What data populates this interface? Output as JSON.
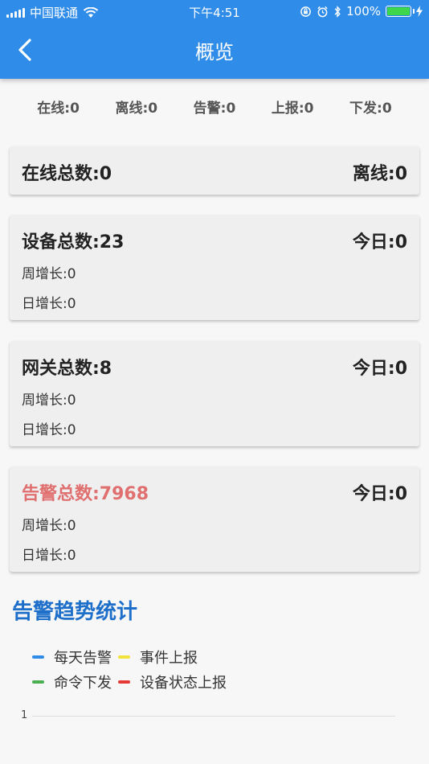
{
  "status_bar": {
    "carrier": "中国联通",
    "time": "下午4:51",
    "battery": "100%",
    "battery_level": 1.0
  },
  "header": {
    "title": "概览",
    "back_icon": "chevron-left-icon"
  },
  "summary": [
    {
      "label": "在线:0"
    },
    {
      "label": "离线:0"
    },
    {
      "label": "告警:0"
    },
    {
      "label": "上报:0"
    },
    {
      "label": "下发:0"
    }
  ],
  "online_card": {
    "total": "在线总数:0",
    "offline": "离线:0"
  },
  "device_card": {
    "total": "设备总数:23",
    "today": "今日:0",
    "weekly": "周增长:0",
    "daily": "日增长:0"
  },
  "gateway_card": {
    "total": "网关总数:8",
    "today": "今日:0",
    "weekly": "周增长:0",
    "daily": "日增长:0"
  },
  "alarm_card": {
    "total": "告警总数:7968",
    "today": "今日:0",
    "weekly": "周增长:0",
    "daily": "日增长:0",
    "accent": "#e07070"
  },
  "trend": {
    "title": "告警趋势统计",
    "legend": [
      {
        "label": "每天告警",
        "color": "#2f8ce8"
      },
      {
        "label": "事件上报",
        "color": "#f2e23c"
      },
      {
        "label": "命令下发",
        "color": "#4caf50"
      },
      {
        "label": "设备状态上报",
        "color": "#e53935"
      }
    ],
    "axis_tick": "1"
  },
  "colors": {
    "primary": "#2f8ce8",
    "section_title": "#1e6fc9"
  }
}
